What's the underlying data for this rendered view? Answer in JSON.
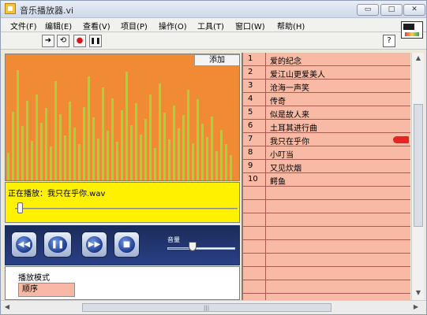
{
  "window": {
    "title": "音乐播放器.vi",
    "controls": {
      "minimize": "▭",
      "maximize": "□",
      "close": "✕"
    }
  },
  "menu": [
    {
      "label": "文件(F)"
    },
    {
      "label": "编辑(E)"
    },
    {
      "label": "查看(V)"
    },
    {
      "label": "项目(P)"
    },
    {
      "label": "操作(O)"
    },
    {
      "label": "工具(T)"
    },
    {
      "label": "窗口(W)"
    },
    {
      "label": "帮助(H)"
    }
  ],
  "toolbar": {
    "buttons": [
      {
        "icon": "run-arrow-icon",
        "glyph": "➜"
      },
      {
        "icon": "run-continuous-icon",
        "glyph": "⟲"
      },
      {
        "icon": "abort-icon",
        "glyph": "●"
      },
      {
        "icon": "pause-icon",
        "glyph": "❚❚"
      }
    ],
    "help": "?"
  },
  "player": {
    "add_button": "添加",
    "now_playing": "正在播放：我只在乎你.wav",
    "progress": 0.02,
    "volume_label": "音量",
    "volume": 0.37,
    "mode_label": "播放模式",
    "mode_value": "顺序"
  },
  "controls": {
    "rew": "◀◀",
    "pause": "❚❚",
    "fwd": "▶▶",
    "stop": "■"
  },
  "playlist": [
    {
      "num": "1",
      "title": "爱的纪念"
    },
    {
      "num": "2",
      "title": "爱江山更爱美人"
    },
    {
      "num": "3",
      "title": "沧海一声笑"
    },
    {
      "num": "4",
      "title": "传奇"
    },
    {
      "num": "5",
      "title": "似是故人来"
    },
    {
      "num": "6",
      "title": "土耳其进行曲"
    },
    {
      "num": "7",
      "title": "我只在乎你"
    },
    {
      "num": "8",
      "title": "小叮当"
    },
    {
      "num": "9",
      "title": "又见炊烟"
    },
    {
      "num": "10",
      "title": "鳄鱼"
    }
  ],
  "current_index": 6,
  "spectrum_levels": [
    0.24,
    0.58,
    0.92,
    0.46,
    0.67,
    0.34,
    0.72,
    0.49,
    0.61,
    0.29,
    0.83,
    0.56,
    0.38,
    0.66,
    0.45,
    0.31,
    0.62,
    0.87,
    0.53,
    0.36,
    0.78,
    0.42,
    0.69,
    0.33,
    0.59,
    0.91,
    0.47,
    0.65,
    0.39,
    0.52,
    0.72,
    0.28,
    0.81,
    0.57,
    0.35,
    0.63,
    0.44,
    0.55,
    0.76,
    0.32,
    0.68,
    0.48,
    0.37,
    0.54,
    0.25,
    0.43,
    0.31,
    0.22
  ]
}
